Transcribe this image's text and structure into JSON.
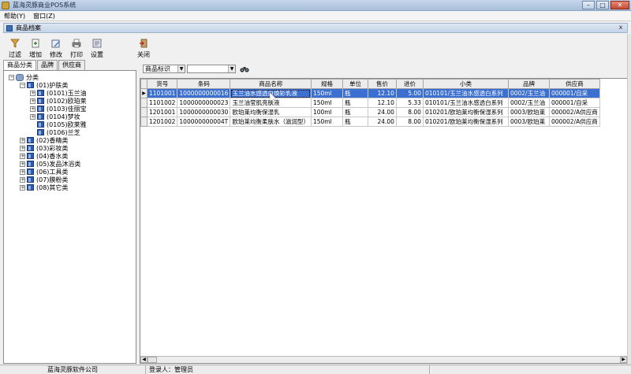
{
  "window": {
    "title": "蓝海灵豚商业POS系统",
    "min_label": "–",
    "max_label": "□",
    "close_label": "✕"
  },
  "menu": [
    "帮助(Y)",
    "窗口(Z)"
  ],
  "child_window": {
    "title": "商品档案",
    "close_label": "x"
  },
  "toolbar": {
    "filter": "过滤",
    "add": "增加",
    "edit": "修改",
    "print": "打印",
    "settings": "设置",
    "close": "关闭"
  },
  "left_tabs": [
    "商品分类",
    "品牌",
    "供应商"
  ],
  "tree": {
    "root": "分类",
    "nodes": [
      {
        "label": "(01)护肤类",
        "children": [
          "(0101)玉兰油",
          "(0102)欧珀莱",
          "(0103)佳丽宝",
          "(0104)梦妆",
          "(0105)欧莱雅",
          "(0106)兰芝"
        ]
      },
      {
        "label": "(02)香精类",
        "children": []
      },
      {
        "label": "(03)彩妆类",
        "children": []
      },
      {
        "label": "(04)香水类",
        "children": []
      },
      {
        "label": "(05)发品沐浴类",
        "children": []
      },
      {
        "label": "(06)工具类",
        "children": []
      },
      {
        "label": "(07)膜粉类",
        "children": []
      },
      {
        "label": "(08)其它类",
        "children": []
      }
    ]
  },
  "filter_field": {
    "selected": "商品标识",
    "value": ""
  },
  "grid": {
    "columns": [
      "货号",
      "条码",
      "商品名称",
      "规格",
      "单位",
      "售价",
      "进价",
      "小类",
      "品牌",
      "供应商"
    ],
    "rows": [
      [
        "1101001",
        "1000000000016",
        "玉兰油水感透白焕彩乳液",
        "150ml",
        "瓶",
        "12.10",
        "5.00",
        "010101/玉兰油水感透白系列",
        "0002/玉兰油",
        "000001/自采"
      ],
      [
        "1101002",
        "1000000000023",
        "玉兰油莹肌亮肤液",
        "150ml",
        "瓶",
        "12.10",
        "5.33",
        "010101/玉兰油水感透白系列",
        "0002/玉兰油",
        "000001/自采"
      ],
      [
        "1201001",
        "1000000000030",
        "欧珀莱均衡保湿乳",
        "100ml",
        "瓶",
        "24.00",
        "8.00",
        "010201/欧珀莱均衡保湿系列",
        "0003/欧珀莱",
        "000002/A供应商"
      ],
      [
        "1201002",
        "100000000004T",
        "欧珀莱均衡柔肤水（滋润型）",
        "150ml",
        "瓶",
        "24.00",
        "8.00",
        "010201/欧珀莱均衡保湿系列",
        "0003/欧珀莱",
        "000002/A供应商"
      ]
    ],
    "selected_row": 0
  },
  "status": {
    "company": "蓝海灵豚软件公司",
    "login": "登录人：管理员"
  }
}
